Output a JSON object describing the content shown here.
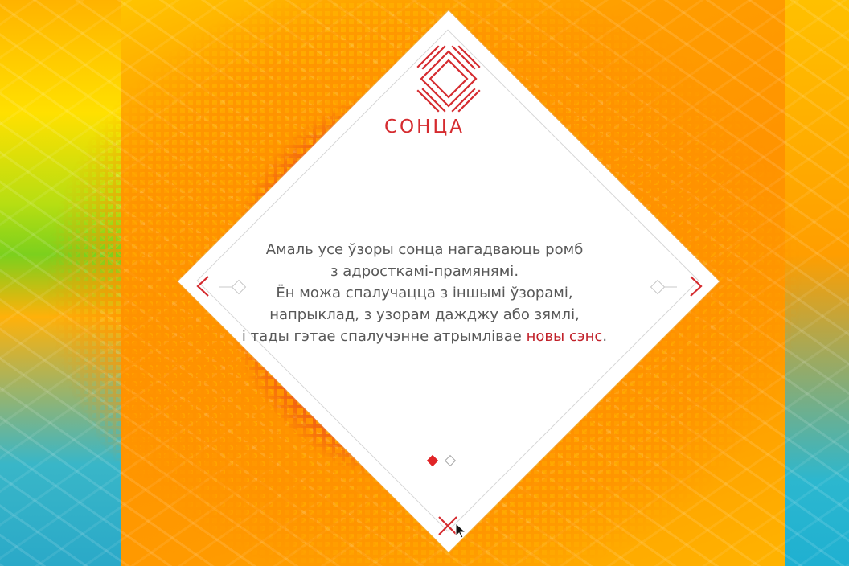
{
  "brand": {
    "title": "СОНЦА"
  },
  "content": {
    "line1": "Амаль усе ўзоры сонца нагадваюць ромб",
    "line2": "з адросткамі-прамянямі.",
    "line3": "Ён можа спалучацца з іншымі ўзорамі,",
    "line4": "напрыклад, з узорам дажджу або зямлі,",
    "line5_prefix": "і тады гэтае спалучэнне атрымлівае ",
    "line5_link": "новы сэнс",
    "line5_suffix": "."
  },
  "navigation": {
    "prev_icon": "chevron-left-icon",
    "next_icon": "chevron-right-icon",
    "close_icon": "close-icon"
  },
  "pagination": {
    "current": 1,
    "total": 2
  },
  "colors": {
    "accent": "#e02427",
    "text": "#585858",
    "card": "#ffffff",
    "background": "#ff9a00"
  }
}
